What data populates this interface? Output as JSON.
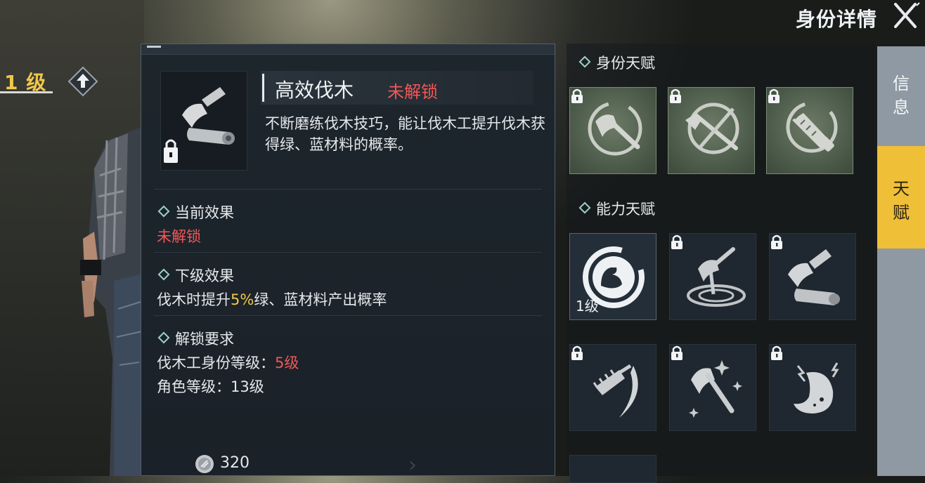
{
  "header": {
    "title": "身份详情",
    "close_icon": "close-x-icon"
  },
  "player": {
    "level_label": "1 级",
    "upgrade_icon": "arrow-up-icon"
  },
  "detail": {
    "skill_name": "高效伐木",
    "status": "未解锁",
    "description": "不断磨练伐木技巧，能让伐木工提升伐木获得绿、蓝材料的概率。",
    "current_effect": {
      "heading": "当前效果",
      "value": "未解锁"
    },
    "next_effect": {
      "heading": "下级效果",
      "prefix": "伐木时提升",
      "percent": "5%",
      "suffix": "绿、蓝材料产出概率"
    },
    "unlock_req": {
      "heading": "解锁要求",
      "line1_label": "伐木工身份等级：",
      "line1_value": "5级",
      "line2": "角色等级：13级"
    },
    "cost": "320"
  },
  "identity_talents": {
    "heading": "身份天赋",
    "tiles": [
      {
        "icon": "axe-circle-icon",
        "locked": true
      },
      {
        "icon": "axe-crossed-circle-icon",
        "locked": true
      },
      {
        "icon": "saw-circle-icon",
        "locked": true
      }
    ]
  },
  "ability_talents": {
    "heading": "能力天赋",
    "tiles": [
      {
        "icon": "muscle-arm-icon",
        "locked": false,
        "level": "1级"
      },
      {
        "icon": "axe-whirl-icon",
        "locked": true
      },
      {
        "icon": "axe-log-icon",
        "locked": true
      },
      {
        "icon": "chainsaw-swing-icon",
        "locked": true
      },
      {
        "icon": "axe-sparkle-icon",
        "locked": true
      },
      {
        "icon": "stomach-energy-icon",
        "locked": true
      }
    ]
  },
  "side_tabs": [
    {
      "label": "信\n息",
      "active": false
    },
    {
      "label": "天\n赋",
      "active": true
    }
  ],
  "colors": {
    "accent_gold": "#f1c84a",
    "locked_red": "#f25757",
    "tab_active": "#f0bf38"
  }
}
